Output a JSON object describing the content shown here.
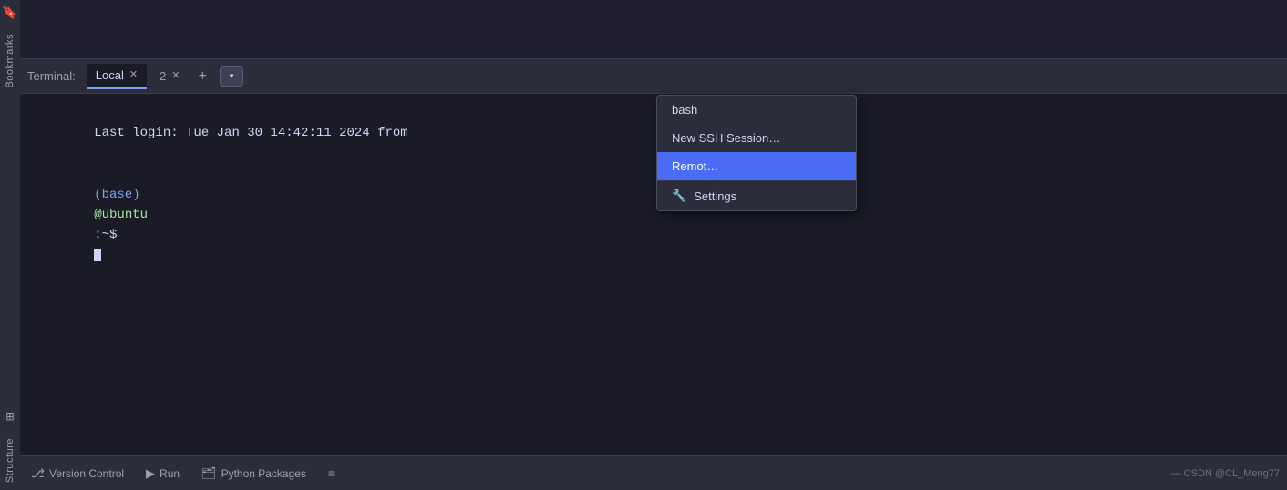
{
  "sidebar": {
    "items": [
      {
        "label": "Bookmarks",
        "icon": "🔖"
      },
      {
        "label": "Structure",
        "icon": "⊞"
      }
    ]
  },
  "terminal": {
    "tab_label": "Terminal:",
    "tabs": [
      {
        "name": "Local",
        "active": true
      },
      {
        "name": "2",
        "active": false
      }
    ],
    "add_button": "+",
    "dropdown_button": "▾",
    "last_login_line": "Last login: Tue Jan 30 14:42:11 2024 from",
    "prompt_user": "@ubuntu",
    "prompt_suffix": ":~$"
  },
  "dropdown": {
    "items": [
      {
        "label": "bash",
        "selected": false
      },
      {
        "label": "New SSH Session…",
        "selected": false
      },
      {
        "label": "Remot…",
        "selected": true
      }
    ],
    "settings_label": "Settings"
  },
  "statusbar": {
    "version_control_label": "Version Control",
    "run_label": "Run",
    "python_packages_label": "Python Packages",
    "list_label": "≡",
    "right_credit": "— CSDN @CL_Meng77"
  }
}
